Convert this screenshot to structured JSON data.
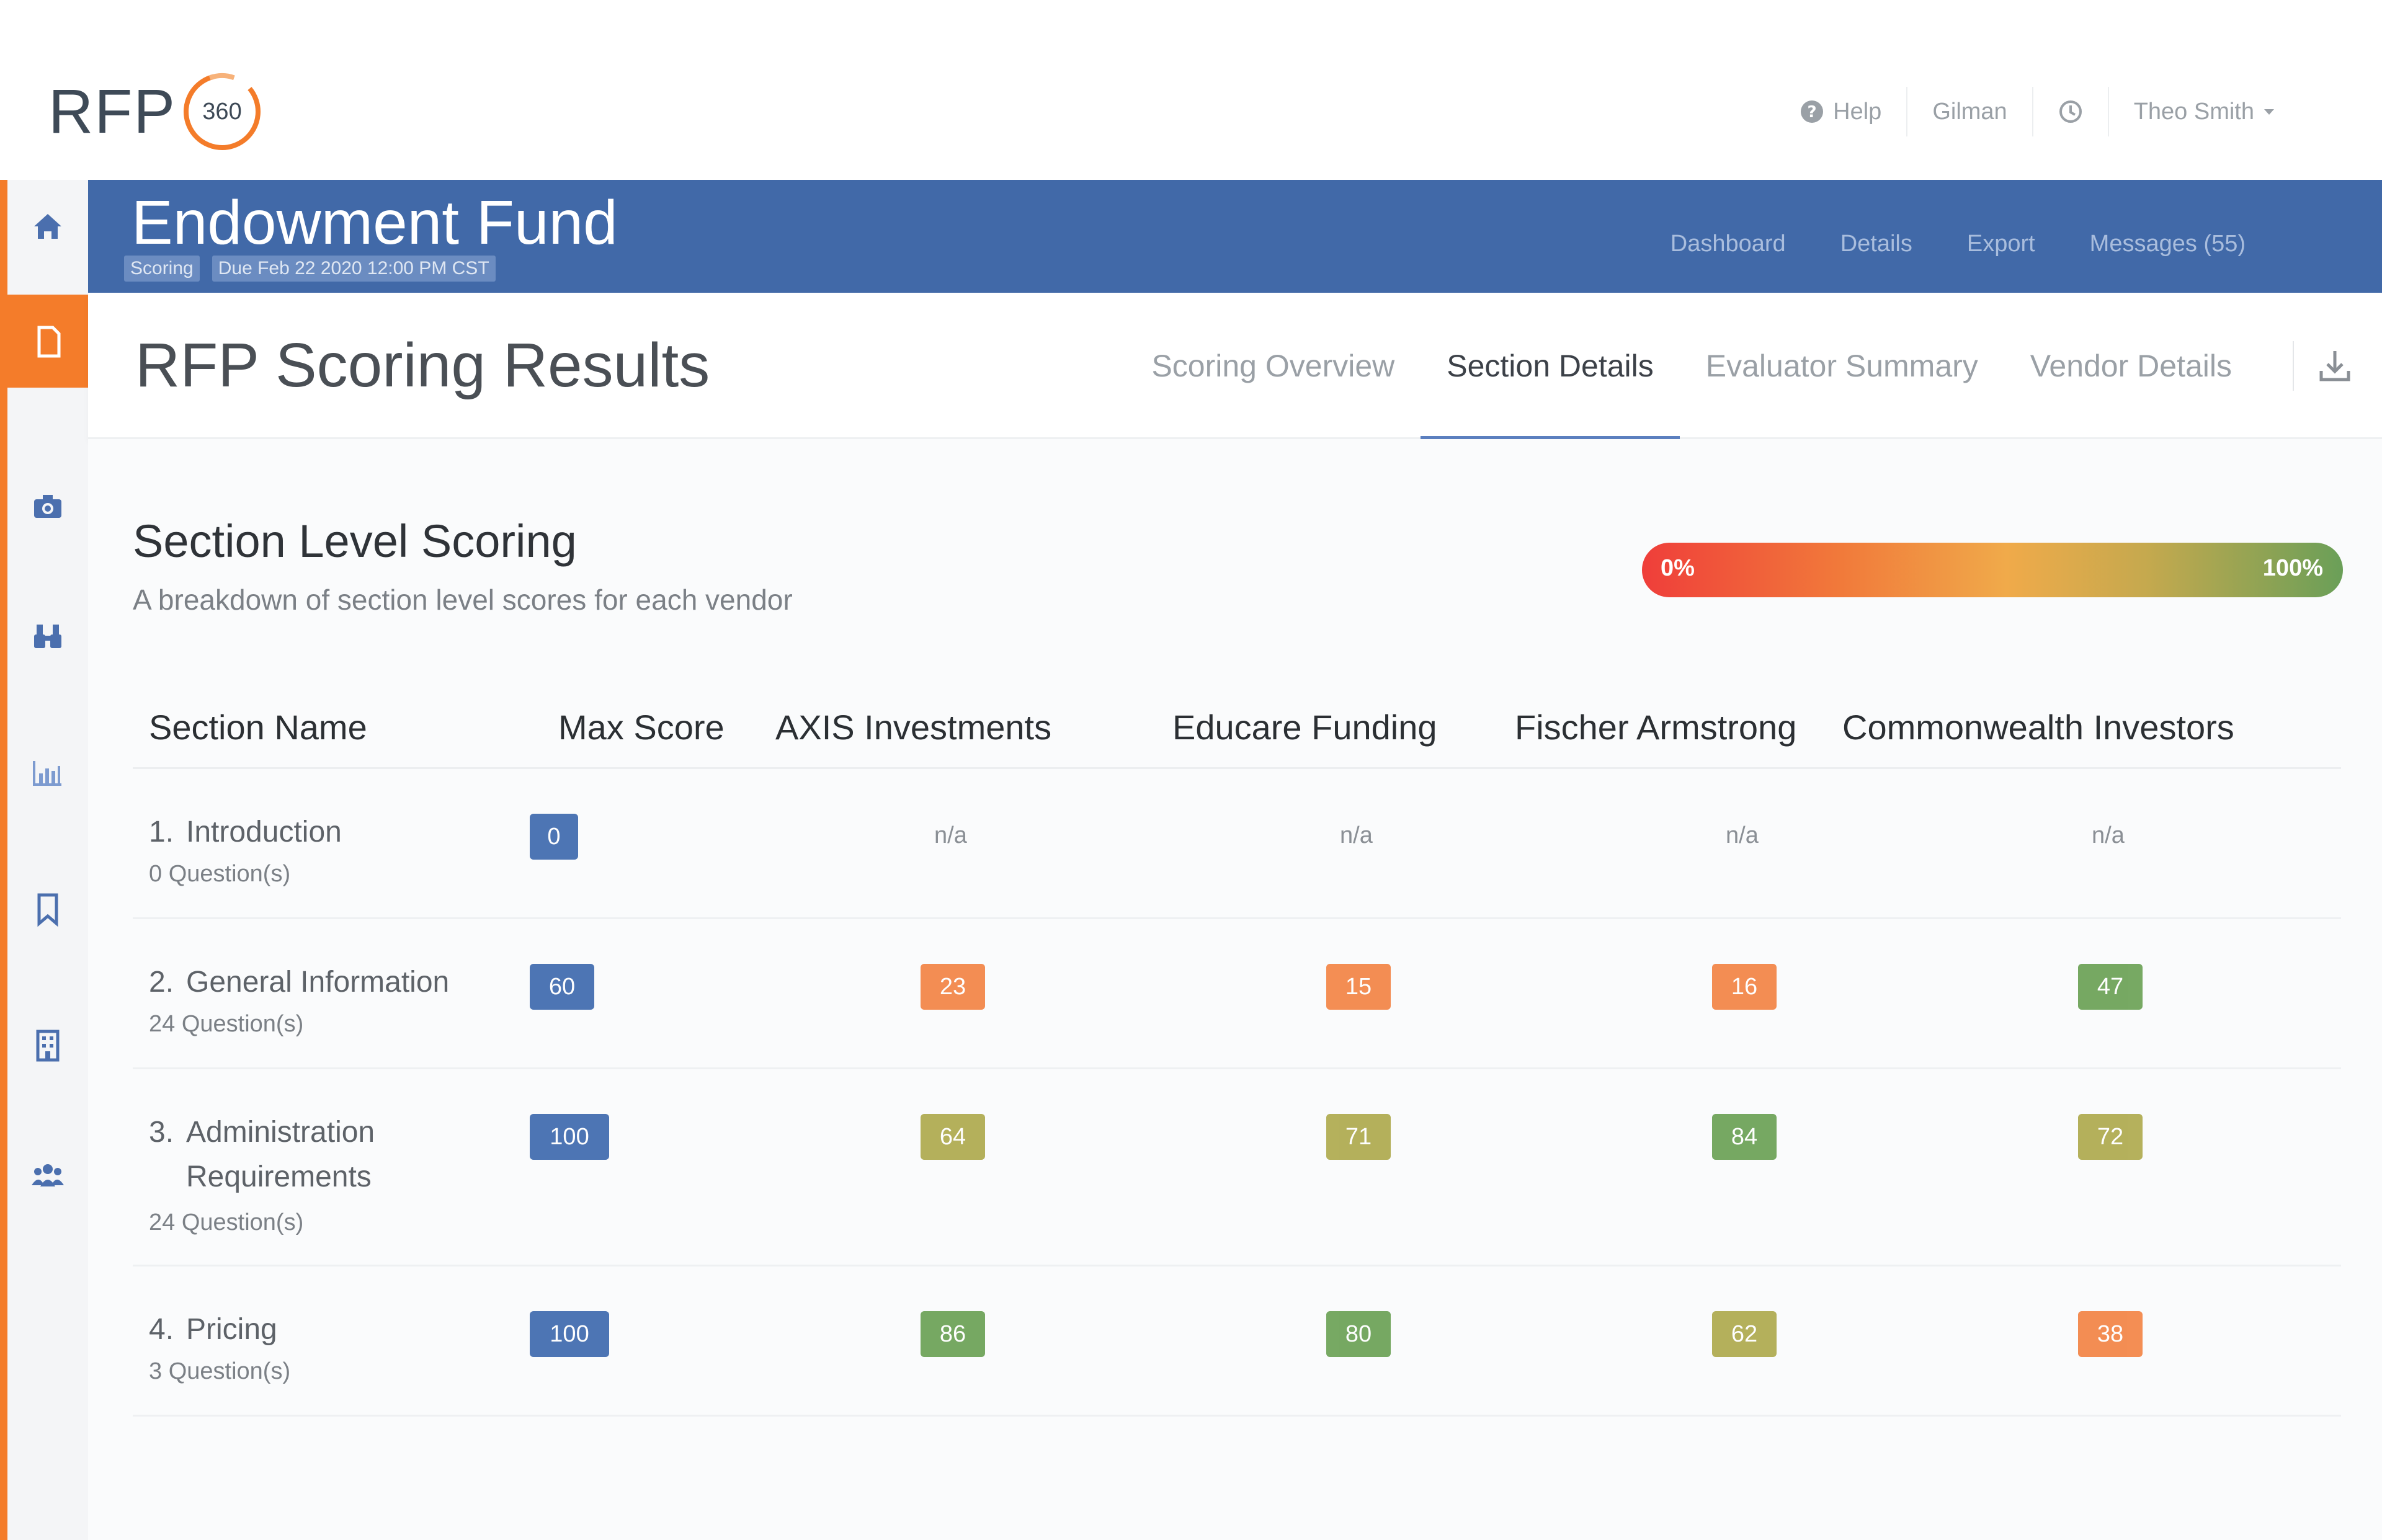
{
  "logo": {
    "text": "RFP",
    "circle_text": "360",
    "colors": {
      "ring": "#f47c2a",
      "text": "#3e4a57"
    }
  },
  "top_nav": {
    "help_label": "Help",
    "org_label": "Gilman",
    "history_icon": "clock-icon",
    "user_label": "Theo Smith"
  },
  "sidebar": {
    "items": [
      {
        "icon": "home-icon"
      },
      {
        "icon": "document-icon",
        "active": true
      },
      {
        "icon": "camera-icon"
      },
      {
        "icon": "binoculars-icon"
      },
      {
        "icon": "bar-chart-icon"
      },
      {
        "icon": "bookmark-icon"
      },
      {
        "icon": "building-icon"
      },
      {
        "icon": "users-icon"
      }
    ]
  },
  "rfp": {
    "title": "Endowment Fund",
    "status_badge": "Scoring",
    "due_badge": "Due Feb 22 2020 12:00 PM CST",
    "nav": [
      "Dashboard",
      "Details",
      "Export",
      "Messages (55)"
    ]
  },
  "page": {
    "title": "RFP Scoring Results",
    "tabs": [
      "Scoring Overview",
      "Section Details",
      "Evaluator Summary",
      "Vendor Details"
    ],
    "active_tab": "Section Details"
  },
  "section": {
    "title": "Section Level Scoring",
    "subtitle": "A breakdown of section level scores for each vendor",
    "scale_min": "0%",
    "scale_max": "100%"
  },
  "table": {
    "headers": {
      "section_name": "Section Name",
      "max_score": "Max Score",
      "vendor1": "AXIS Investments",
      "vendor2": "Educare Funding",
      "vendor3": "Fischer Armstrong",
      "vendor4": "Commonwealth Investors"
    },
    "rows": [
      {
        "num": "1.",
        "name_line1": "Introduction",
        "name_line2": "",
        "questions": "0 Question(s)",
        "max": "0",
        "v1": "n/a",
        "v2": "n/a",
        "v3": "n/a",
        "v4": "n/a"
      },
      {
        "num": "2.",
        "name_line1": "General Information",
        "name_line2": "",
        "questions": "24 Question(s)",
        "max": "60",
        "v1": "23",
        "v2": "15",
        "v3": "16",
        "v4": "47"
      },
      {
        "num": "3.",
        "name_line1": "Administration",
        "name_line2": "Requirements",
        "questions": "24 Question(s)",
        "max": "100",
        "v1": "64",
        "v2": "71",
        "v3": "84",
        "v4": "72"
      },
      {
        "num": "4.",
        "name_line1": "Pricing",
        "name_line2": "",
        "questions": "3 Question(s)",
        "max": "100",
        "v1": "86",
        "v2": "80",
        "v3": "62",
        "v4": "38"
      }
    ]
  },
  "colors": {
    "accent_orange": "#f47c2a",
    "header_blue": "#4169a8",
    "max_score_blue": "#2f5ea8",
    "score_low": "#f27a36",
    "score_mid": "#a8a33f",
    "score_high": "#5f9a48"
  }
}
